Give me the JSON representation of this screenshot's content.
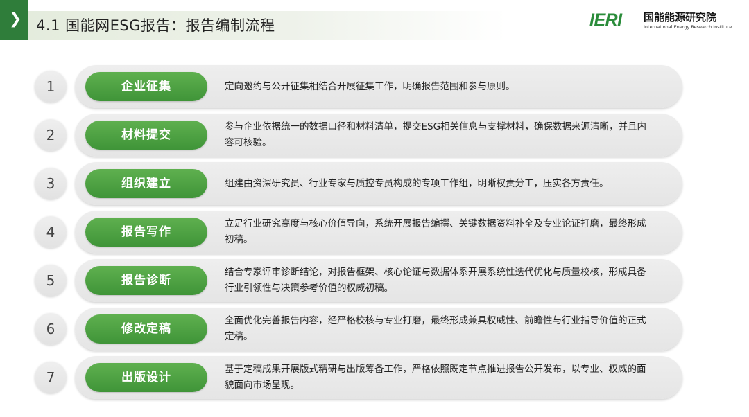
{
  "header": {
    "title": "4.1  国能网ESG报告：报告编制流程",
    "logo_mark": "IERI",
    "logo_name": "国能能源研究院",
    "logo_subtitle": "International Energy Research Institute",
    "accent_color": "#2f7d3a"
  },
  "steps": [
    {
      "number": "1",
      "label": "企业征集",
      "description": "定向邀约与公开征集相结合开展征集工作，明确报告范围和参与原则。"
    },
    {
      "number": "2",
      "label": "材料提交",
      "description": "参与企业依据统一的数据口径和材料清单，提交ESG相关信息与支撑材料，确保数据来源清晰，并且内容可核验。"
    },
    {
      "number": "3",
      "label": "组织建立",
      "description": "组建由资深研究员、行业专家与质控专员构成的专项工作组，明晰权责分工，压实各方责任。"
    },
    {
      "number": "4",
      "label": "报告写作",
      "description": "立足行业研究高度与核心价值导向，系统开展报告编撰、关键数据资料补全及专业论证打磨，最终形成初稿。"
    },
    {
      "number": "5",
      "label": "报告诊断",
      "description": "结合专家评审诊断结论，对报告框架、核心论证与数据体系开展系统性迭代优化与质量校核，形成具备行业引领性与决策参考价值的权威初稿。"
    },
    {
      "number": "6",
      "label": "修改定稿",
      "description": "全面优化完善报告内容，经严格校核与专业打磨，最终形成兼具权威性、前瞻性与行业指导价值的正式定稿。"
    },
    {
      "number": "7",
      "label": "出版设计",
      "description": "基于定稿成果开展版式精研与出版筹备工作，严格依照既定节点推进报告公开发布，以专业、权威的面貌面向市场呈现。"
    }
  ],
  "colors": {
    "label_green": "#4aa040",
    "pill_gray": "#e9e9e9"
  }
}
